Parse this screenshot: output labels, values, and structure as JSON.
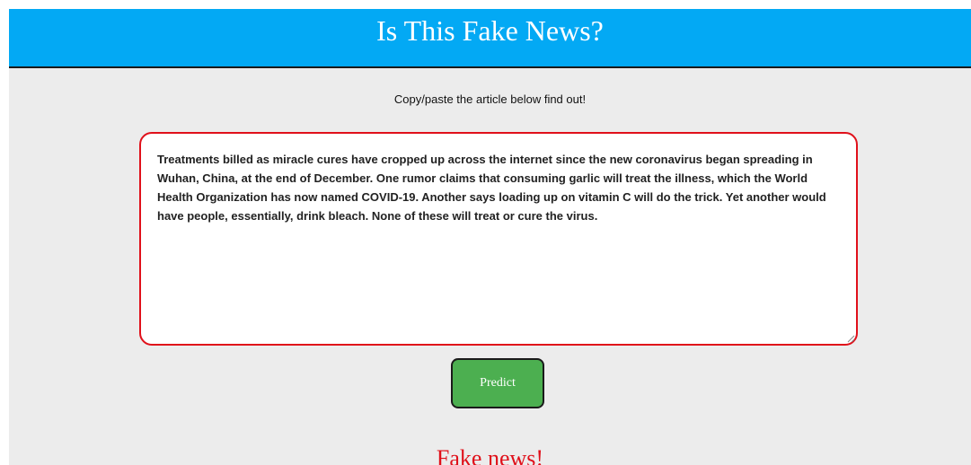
{
  "header": {
    "title": "Is This Fake News?"
  },
  "form": {
    "instruction": "Copy/paste the article below find out!",
    "article_text": "Treatments billed as miracle cures have cropped up across the internet since the new coronavirus began spreading in Wuhan, China, at the end of December. One rumor claims that consuming garlic will treat the illness, which the World Health Organization has now named COVID-19. Another says loading up on vitamin C will do the trick. Yet another would have people, essentially, drink bleach. None of these will treat or cure the virus.",
    "predict_label": "Predict"
  },
  "result": {
    "text": "Fake news!"
  },
  "colors": {
    "header_bg": "#03a9f4",
    "page_bg": "#ececec",
    "textarea_border": "#e0101a",
    "button_bg": "#4caf50",
    "result_text": "#e0101a"
  }
}
